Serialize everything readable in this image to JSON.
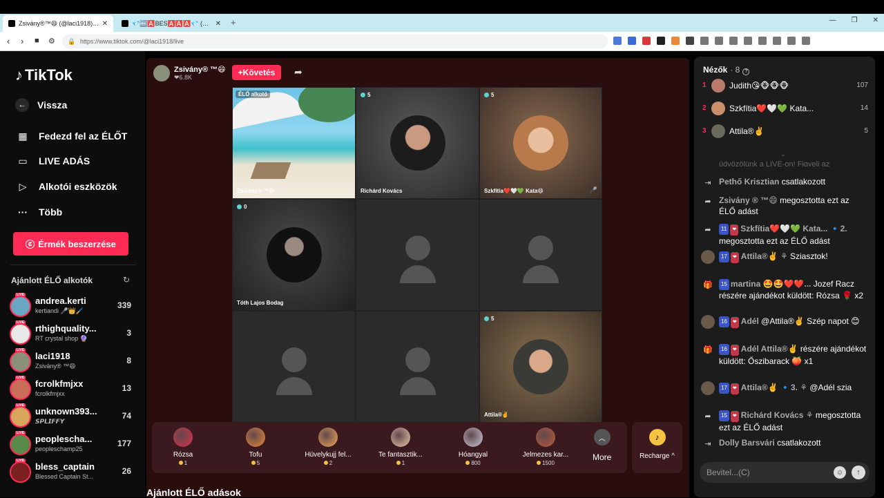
{
  "browser": {
    "tabs": [
      {
        "title": "Zsivány®™😄 (@laci1918) É..."
      },
      {
        "title": "💎🔤🅰️BES🅰️🅰️🅰️💎 (@csby0..."
      }
    ],
    "url": "https://www.tiktok.com/@laci1918/live"
  },
  "sidebar": {
    "logo": "TikTok",
    "back": "Vissza",
    "nav": [
      "Fedezd fel az ÉLŐT",
      "LIVE ADÁS",
      "Alkotói eszközök",
      "Több"
    ],
    "coins_button": "Érmék beszerzése",
    "recommended_title": "Ajánlott ÉLŐ alkotók",
    "live_badge": "LIVE",
    "creators": [
      {
        "name": "andrea.kerti",
        "sub": "kertiandi 🎤👑🖌️",
        "count": "339",
        "color": "#6aa7c4"
      },
      {
        "name": "rthighquality...",
        "sub": "RT crystal shop 🔮",
        "count": "3",
        "color": "#e8e8e8"
      },
      {
        "name": "laci1918",
        "sub": "Zsivány® ™😄",
        "count": "8",
        "color": "#8a8f7a"
      },
      {
        "name": "fcrolkfmjxx",
        "sub": "fcrolkfmjxx",
        "count": "13",
        "color": "#c86e58"
      },
      {
        "name": "unknown393...",
        "sub": "𝙎𝙋𝙇𝙄𝙁𝙁𝙔",
        "count": "74",
        "color": "#d8a65a"
      },
      {
        "name": "peoplescha...",
        "sub": "peopleschamp25",
        "count": "177",
        "color": "#5a8a4a"
      },
      {
        "name": "bless_captain",
        "sub": "Blessed Captain St...",
        "count": "26",
        "color": "#7a2020"
      }
    ]
  },
  "stream": {
    "host_name": "Zsivány® ™😄",
    "host_likes": "❤6.8K",
    "follow_label": "+Követés",
    "share_icon": "share-arrow-icon",
    "live_tag": "ÉLŐ alkotó",
    "cells": [
      {
        "name": "Zsivány® ™😄",
        "badge": ""
      },
      {
        "name": "Richárd Kovács",
        "badge": "5"
      },
      {
        "name": "Szkfítia❤️🤍💚 Kata😄",
        "badge": "5"
      },
      {
        "name": "Tóth Lajos Bodag",
        "badge": "0"
      },
      {
        "name": "",
        "badge": ""
      },
      {
        "name": "",
        "badge": ""
      },
      {
        "name": "",
        "badge": ""
      },
      {
        "name": "",
        "badge": ""
      },
      {
        "name": "Attila®✌️",
        "badge": "5"
      }
    ],
    "gifts": [
      {
        "name": "Rózsa",
        "price": "1",
        "color": "#d8314a"
      },
      {
        "name": "Tofu",
        "price": "5",
        "color": "#e88a3a"
      },
      {
        "name": "Hüvelykujj fel...",
        "price": "2",
        "color": "#f0a85a"
      },
      {
        "name": "Te fantasztik...",
        "price": "1",
        "color": "#e8c8a8"
      },
      {
        "name": "Hóangyal",
        "price": "800",
        "color": "#c8c8d8"
      },
      {
        "name": "Jelmezes kar...",
        "price": "1500",
        "color": "#b85a3a"
      }
    ],
    "more_label": "More",
    "recharge_label": "Recharge ^",
    "recommended_live_title": "Ajánlott ÉLŐ adások"
  },
  "viewers_panel": {
    "title": "Nézők",
    "count": "· 8",
    "top": [
      {
        "rank": "1",
        "name": "Judith😘🐵🐵🐵",
        "score": "107",
        "color": "#b87a6a"
      },
      {
        "rank": "2",
        "name": "Szkfítia❤️🤍💚 Kata...",
        "score": "14",
        "color": "#c8906a"
      },
      {
        "rank": "3",
        "name": "Attila®✌️",
        "score": "5",
        "color": "#6a6a5a"
      }
    ],
    "ghost_text": "üdvözölünk a LIVE-on! Figyelj az irányelveinkre.",
    "messages": [
      {
        "icon": "enter-icon",
        "user": "Pethő Krisztian",
        "text": "csatlakozott",
        "lv": "",
        "fb": "",
        "extra": ""
      },
      {
        "icon": "share-icon",
        "user": "Zsivány ® ™😄",
        "text": "megosztotta ezt az ÉLŐ adást",
        "lv": "",
        "fb": "",
        "extra": ""
      },
      {
        "icon": "share-icon",
        "user": "Szkfítia❤️🤍💚 Kata...",
        "text": "megosztotta ezt az ÉLŐ adást",
        "lv": "11",
        "fb": "❤",
        "extra": "🔹2."
      },
      {
        "icon": "avatar",
        "user": "Attila®✌️ ⚘",
        "text": "Sziasztok!",
        "lv": "17",
        "fb": "❤",
        "extra": ""
      },
      {
        "icon": "gift-icon",
        "user": "martina 🤩🤩❤️❤️...",
        "text": "Jozef Racz részére ajándékot küldött: Rózsa 🌹 x2",
        "lv": "15",
        "fb": "",
        "extra": ""
      },
      {
        "icon": "avatar",
        "user": "Adél",
        "text": "@Attila®✌️ Szép napot 😊",
        "lv": "16",
        "fb": "❤",
        "extra": ""
      },
      {
        "icon": "gift-icon",
        "user": "Adél Attila®✌️",
        "text": "részére ajándékot küldött: Őszibarack 🍑 x1",
        "lv": "16",
        "fb": "❤",
        "extra": ""
      },
      {
        "icon": "avatar",
        "user": "Attila®✌️",
        "text": "@Adél szia",
        "lv": "17",
        "fb": "❤",
        "extra": "🔹3. ⚘"
      },
      {
        "icon": "share-icon",
        "user": "Richárd Kovács ⚘",
        "text": "megosztotta ezt az ÉLŐ adást",
        "lv": "15",
        "fb": "❤",
        "extra": ""
      },
      {
        "icon": "enter-icon",
        "user": "Dolly Barsvári",
        "text": "csatlakozott",
        "lv": "",
        "fb": "",
        "extra": ""
      }
    ],
    "input_placeholder": "Bevitel...(C)"
  }
}
